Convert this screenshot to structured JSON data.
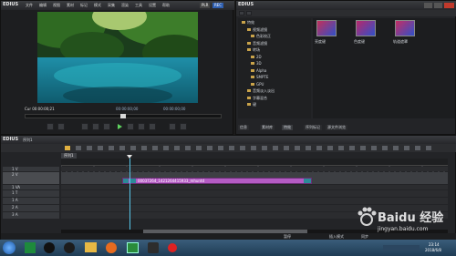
{
  "player": {
    "logo": "EDIUS",
    "menu": [
      "文件",
      "编辑",
      "视图",
      "素材",
      "标记",
      "模式",
      "采集",
      "渲染",
      "工具",
      "设置",
      "帮助"
    ],
    "mode_badge": "PLR",
    "mode_badge2": "REC",
    "cur_timecode": "Cur 00:00:00;21",
    "in_timecode": "00:00:00;00",
    "out_timecode": "00:00:00;00"
  },
  "bin": {
    "logo": "EDIUS",
    "tree": [
      "特效",
      "视频滤镜",
      "色彩校正",
      "音频滤镜",
      "转场",
      "2D",
      "3D",
      "Alpha",
      "SMPTE",
      "GPU",
      "音频淡入淡出",
      "字幕混合",
      "键"
    ],
    "effects": [
      {
        "name": "亮度键",
        "color": "#c2305a"
      },
      {
        "name": "色度键",
        "color": "#b8286a"
      },
      {
        "name": "轨道遮罩",
        "color": "#c52e64"
      }
    ],
    "tabs": [
      "信息",
      "素材库",
      "特效",
      "序列标记",
      "源文件浏览"
    ]
  },
  "timeline": {
    "logo": "EDIUS",
    "sequence_label": "序列1",
    "sequence_tab": "序列1",
    "clip_label": "00037264_1421264415933_mhuntd",
    "tracks": [
      {
        "name": "1 V",
        "type": "video"
      },
      {
        "name": "2 V",
        "type": "video"
      },
      {
        "name": "1 VA",
        "type": "va"
      },
      {
        "name": "1 T",
        "type": "title"
      },
      {
        "name": "1 A",
        "type": "audio"
      },
      {
        "name": "2 A",
        "type": "audio"
      },
      {
        "name": "3 A",
        "type": "audio"
      }
    ],
    "status_left": "暂停",
    "status_mid": "插入模式",
    "status_right": "同步"
  },
  "taskbar": {
    "time": "23:14",
    "date": "2018/6/8",
    "apps": [
      "start",
      "spreadsheet",
      "qq",
      "chat",
      "folder",
      "firefox",
      "edius",
      "media",
      "record"
    ]
  },
  "watermark": {
    "line1": "Baidu 经验",
    "line2": "jingyan.baidu.com"
  }
}
